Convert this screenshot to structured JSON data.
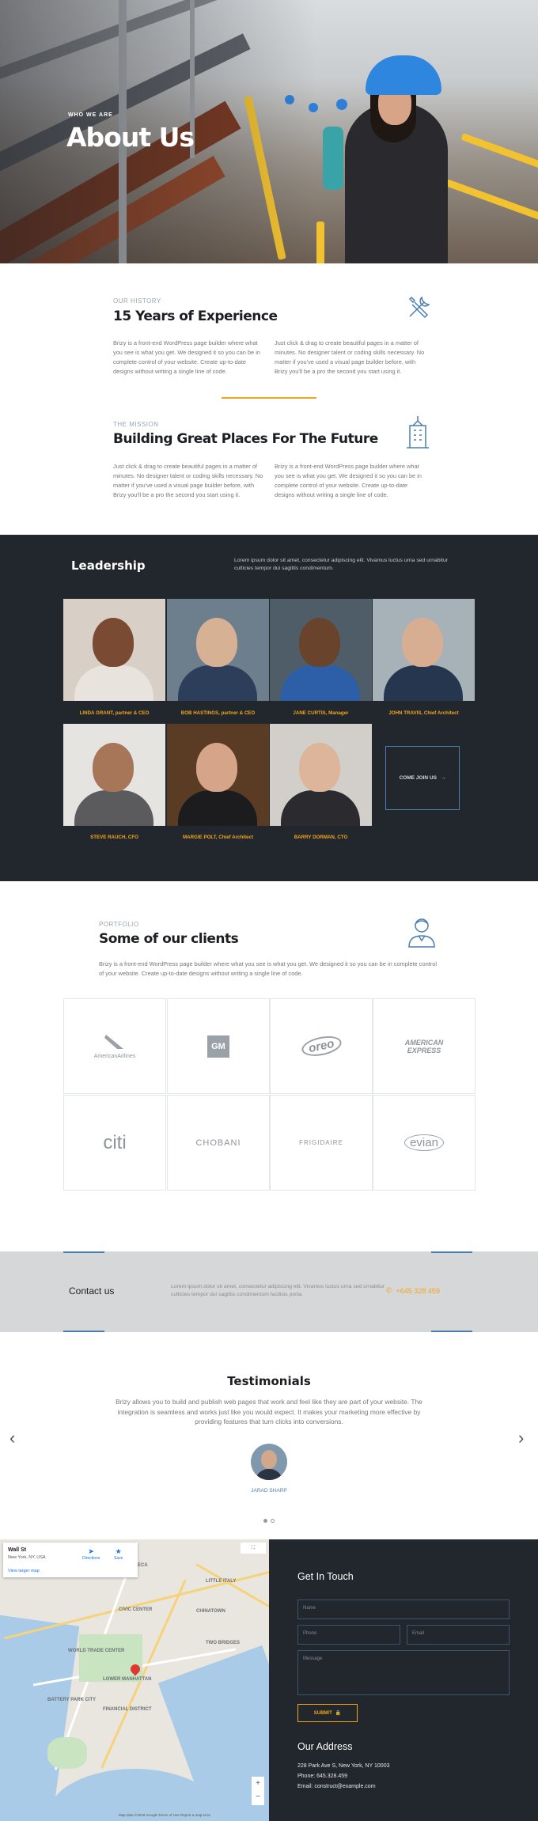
{
  "hero": {
    "kicker": "WHO WE ARE",
    "title": "About Us"
  },
  "history": {
    "kicker": "OUR HISTORY",
    "title": "15 Years of Experience",
    "icon": "tools-icon",
    "col1": "Brizy is a front-end WordPress page builder where what you see is what you get. We designed it so you can be in complete control of your website. Create up-to-date designs without writing a single line of code.",
    "col2": "Just click & drag to create beautiful pages in a matter of minutes. No designer talent or coding skills necessary. No matter if you've used a visual page builder before, with Brizy you'll be a pro the second you start using it."
  },
  "mission": {
    "kicker": "THE MISSION",
    "title": "Building Great Places For The Future",
    "icon": "skyscraper-icon",
    "col1": "Just click & drag to create beautiful pages in a matter of minutes. No designer talent or coding skills necessary. No matter if you've used a visual page builder before, with Brizy you'll be a pro the second you start using it.",
    "col2": "Brizy is a front-end WordPress page builder where what you see is what you get. We designed it so you can be in complete control of your website. Create up-to-date designs without writing a single line of code."
  },
  "leadership": {
    "title": "Leadership",
    "description": "Lorem ipsum dolor sit amet, consectetur adipiscing elit. Vivamus luctus urna sed urnabitur culticies tempor dui sagittis condimentum.",
    "join_label": "COME JOIN US",
    "members": [
      {
        "name": "LINDA GRANT, partner & CEO"
      },
      {
        "name": "BOB HASTINGS, partner & CEO"
      },
      {
        "name": "JANE CURTIS, Manager"
      },
      {
        "name": "JOHN TRAVIS, Chief Architect"
      },
      {
        "name": "STEVE RAUCH, CFO"
      },
      {
        "name": "MARGIE POLT, Chief Architect"
      },
      {
        "name": "BARRY DORMAN, CTO"
      }
    ]
  },
  "clients": {
    "kicker": "PORTFOLIO",
    "title": "Some of our clients",
    "icon": "person-icon",
    "description": "Brizy is a front-end WordPress page builder where what you see is what you get. We designed it so you can be in complete control of your website. Create up-to-date designs without writing a single line of code.",
    "logos": [
      "AmericanAirlines",
      "GM",
      "oreo",
      "AMERICAN EXPRESS",
      "citi",
      "CHOBANI",
      "FRIGIDAIRE",
      "evian"
    ]
  },
  "contact_band": {
    "title": "Contact us",
    "text": "Lorem ipsum dolor sit amet, consectetur adipiscing elit. Vivamus luctus urna sed urnabitur culticies tempor dui sagittis condimentum facilisis porta.",
    "phone": "+645 328 459",
    "phone_icon": "phone-icon"
  },
  "testimonials": {
    "title": "Testimonials",
    "quote": "Brizy allows you to build and publish web pages that work and feel like they are part of your website. The integration is seamless and works just like you would expect. It makes your marketing more effective by providing features that turn clicks into conversions.",
    "author": "JARAD SHARP",
    "prev": "‹",
    "next": "›"
  },
  "map": {
    "place": "Wall St",
    "address": "New York, NY, USA",
    "directions": "Directions",
    "save": "Save",
    "larger": "View larger map",
    "labels": [
      "TRIBECA",
      "CIVIC CENTER",
      "LOWER MANHATTAN",
      "FINANCIAL DISTRICT",
      "WORLD TRADE CENTER",
      "TWO BRIDGES",
      "CHINATOWN",
      "BATTERY PARK CITY",
      "LITTLE ITALY"
    ],
    "footer": "Map data ©2019 Google   Terms of Use   Report a map error"
  },
  "get_in_touch": {
    "title": "Get In Touch",
    "name_placeholder": "Name",
    "phone_placeholder": "Phone",
    "email_placeholder": "Email",
    "message_placeholder": "Message",
    "submit_label": "SUBMIT",
    "address_title": "Our Address",
    "address": "228 Park Ave S, New York, NY 10003",
    "phone": "Phone: 645.328.459",
    "email": "Email: construct@example.com"
  },
  "colors": {
    "accent": "#f2a51c",
    "dark": "#22272d",
    "blue": "#4a7eb0"
  }
}
